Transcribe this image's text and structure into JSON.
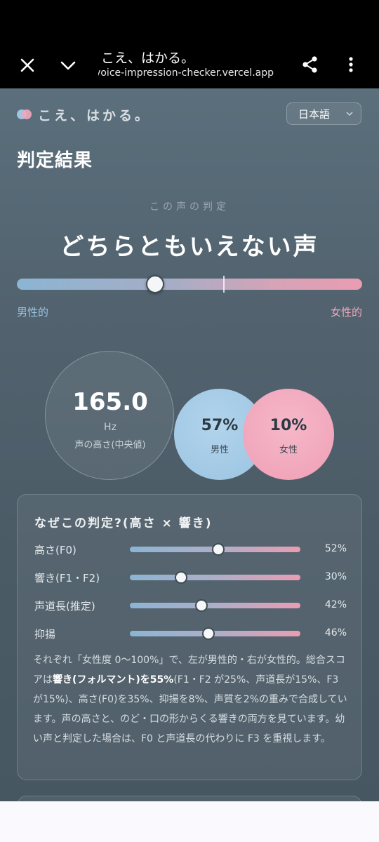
{
  "browser": {
    "title": "こえ、はかる。",
    "url": "voice-impression-checker.vercel.app",
    "icons": [
      "close-icon",
      "chevron-down-icon",
      "share-icon",
      "more-vert-icon"
    ]
  },
  "header": {
    "logo_text": "こえ、はかる。",
    "language": "日本語"
  },
  "result": {
    "heading": "判定結果",
    "label": "この声の判定",
    "verdict": "どちらともいえない声",
    "position": 0.4,
    "scale_left": "男性的",
    "scale_right": "女性的"
  },
  "pitch": {
    "value": "165.0",
    "unit": "Hz",
    "caption": "声の高さ(中央値)"
  },
  "male": {
    "percent": "57%",
    "label": "男性"
  },
  "female": {
    "percent": "10%",
    "label": "女性"
  },
  "breakdown": {
    "title": "なぜこの判定?(高さ × 響き)",
    "rows": [
      {
        "label": "高さ(F0)",
        "value": "52%",
        "level": 0.52
      },
      {
        "label": "響き(F1・F2)",
        "value": "30%",
        "level": 0.3
      },
      {
        "label": "声道長(推定)",
        "value": "42%",
        "level": 0.42
      },
      {
        "label": "抑揚",
        "value": "46%",
        "level": 0.46
      }
    ],
    "desc_1": "それぞれ「女性度 0〜100%」で、左が男性的・右が女性的。総合スコアは",
    "desc_bold": "響き(フォルマント)を55%",
    "desc_2": "(F1・F2 が25%、声道長が15%、F3 が15%)、高さ(F0)を35%、抑揚を8%、声質を2%の重みで合成しています。声の高さと、のど・口の形からくる響きの両方を見ています。幼い声と判定した場合は、F0 と声道長の代わりに F3 を重視します。"
  },
  "colors": {
    "male": "#9ac3e1",
    "female": "#ef9fb5",
    "background": "#52636f"
  }
}
